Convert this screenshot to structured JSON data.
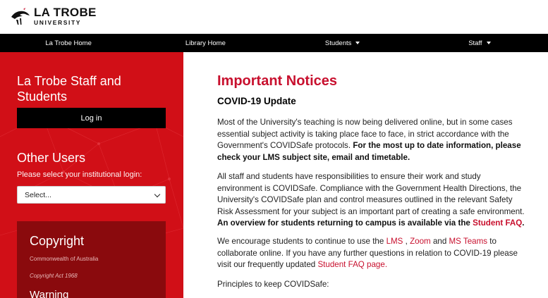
{
  "header": {
    "logo_main": "LA TROBE",
    "logo_sub": "UNIVERSITY"
  },
  "navbar": {
    "items": [
      {
        "label": "La Trobe Home",
        "dropdown": false
      },
      {
        "label": "Library Home",
        "dropdown": false
      },
      {
        "label": "Students",
        "dropdown": true
      },
      {
        "label": "Staff",
        "dropdown": true
      }
    ]
  },
  "sidebar": {
    "staff_title": "La Trobe Staff and Students",
    "login_label": "Log in",
    "other_title": "Other Users",
    "other_subtitle": "Please select your institutional login:",
    "select_value": "Select...",
    "copyright": {
      "title": "Copyright",
      "line1": "Commonwealth of Australia",
      "line2": "Copyright Act 1968",
      "warning": "Warning"
    }
  },
  "main": {
    "title": "Important Notices",
    "subtitle": "COVID-19 Update",
    "p1_text": "Most of the University's teaching is now being delivered online, but in some cases essential subject activity is taking place face to face, in strict accordance with the Government's COVIDSafe protocols. ",
    "p1_bold": "For the most up to date information, please check your LMS subject site, email and timetable.",
    "p2_text": "All staff and students have responsibilities to ensure their work and study environment is COVIDSafe. Compliance with the Government Health Directions, the University's COVIDSafe plan and control measures outlined in the relevant Safety Risk Assessment for your subject is an important part of creating a safe environment. ",
    "p2_bold": "An overview for students returning to campus is available via the ",
    "p2_link": "Student FAQ",
    "p2_end": ".",
    "p3_a": "We encourage students to continue to use the ",
    "p3_link1": "LMS",
    "p3_b": " , ",
    "p3_link2": "Zoom",
    "p3_c": "  and ",
    "p3_link3": "MS Teams",
    "p3_d": "  to collaborate online. If you have any further questions in relation to COVID-19 please visit our frequently updated ",
    "p3_link4": "Student FAQ page.",
    "p4_text": "Principles to keep COVIDSafe:"
  },
  "colors": {
    "sidebar_red": "#d10f17",
    "copyright_box": "#8a0a0d",
    "accent_red": "#c8102e",
    "navbar": "#000000"
  },
  "icons": [
    "la-trobe-logo-icon",
    "chevron-down-icon"
  ]
}
